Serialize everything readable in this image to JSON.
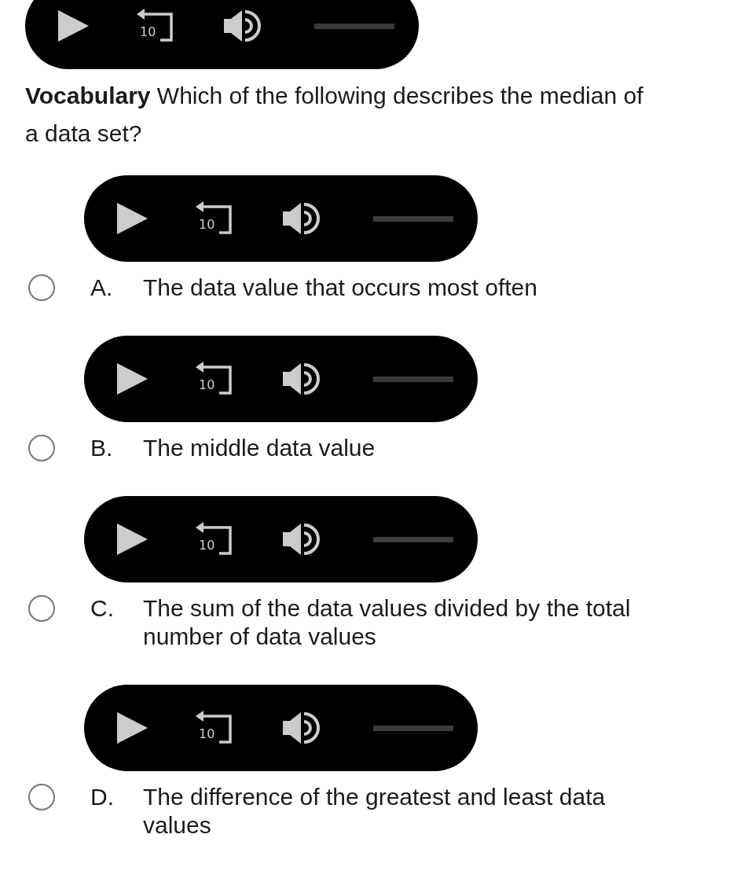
{
  "question_player": {
    "replay_label": "10"
  },
  "question": "**Vocabulary** Which of the following describes the median of a data set?",
  "options": [
    {
      "letter": "A.",
      "text": "The data value that occurs most often",
      "selected": false,
      "player": {
        "replay_label": "10"
      }
    },
    {
      "letter": "B.",
      "text": "The middle data value",
      "selected": false,
      "player": {
        "replay_label": "10"
      }
    },
    {
      "letter": "C.",
      "text": "The sum of the data values divided by the total number of data values",
      "selected": false,
      "player": {
        "replay_label": "10"
      }
    },
    {
      "letter": "D.",
      "text": "The difference of the greatest and least data values",
      "selected": false,
      "player": {
        "replay_label": "10"
      }
    }
  ]
}
